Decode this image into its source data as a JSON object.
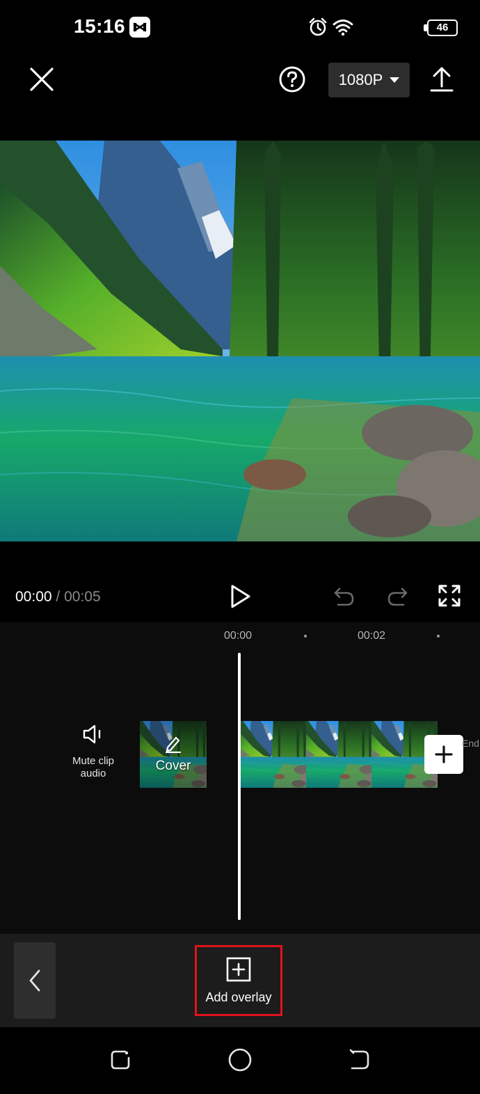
{
  "status_bar": {
    "time": "15:16",
    "battery_level": "46",
    "icons": [
      "capcut-icon",
      "alarm-icon",
      "wifi-icon",
      "battery-icon"
    ]
  },
  "toolbar": {
    "close_icon": "close-icon",
    "help_icon": "help-icon",
    "resolution": "1080P",
    "export_icon": "upload-icon"
  },
  "player": {
    "current_time": "00:00",
    "separator": "/",
    "total_time": "00:05",
    "icons": [
      "play-icon",
      "undo-icon",
      "redo-icon",
      "fullscreen-icon"
    ]
  },
  "timeline": {
    "ruler": [
      "00:00",
      "00:02"
    ],
    "mute_label": "Mute clip audio",
    "cover_label": "Cover",
    "end_label": "End",
    "clip_frames": 3
  },
  "bottom_tools": {
    "back_icon": "chevron-left-icon",
    "add_overlay_label": "Add overlay",
    "highlight_color": "#e0131b"
  },
  "nav_bar": {
    "icons": [
      "recents-icon",
      "home-icon",
      "back-icon"
    ]
  }
}
